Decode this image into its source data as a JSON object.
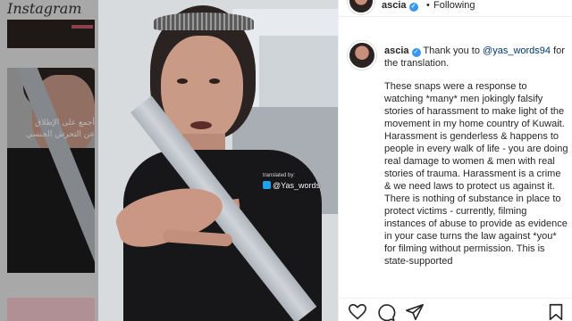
{
  "background_feed": {
    "logo_text": "Instagram",
    "arabic_caption_line1": "أجمع على الإطلاق",
    "arabic_caption_line2": "عن التحرش الجنسي"
  },
  "video": {
    "watermark_prefix": "translated by:",
    "watermark_handle": "@Yas_words"
  },
  "header": {
    "username": "ascia",
    "separator": "•",
    "follow_status": "Following"
  },
  "caption": {
    "username": "ascia",
    "thanks_text": "Thank you to",
    "mention": "@yas_words94",
    "thanks_suffix": "for the translation.",
    "body": "These snaps were a response to watching *many* men jokingly falsify stories of harassment to make light of the movement in my home country of Kuwait. Harassment is genderless & happens to people in every walk of life - you are doing real damage to women & men with real stories of trauma. Harassment is a crime & we need laws to protect us against it. There is nothing of substance in place to protect victims - currently, filming instances of abuse to provide as evidence in your case turns the law against *you* for filming without permission. This is state-supported"
  },
  "icons": {
    "verified": "verified-badge-icon",
    "like": "heart-icon",
    "comment": "comment-icon",
    "share": "paper-plane-icon",
    "save": "bookmark-icon"
  },
  "colors": {
    "verified_blue": "#3897f0",
    "mention_blue": "#00376b",
    "text": "#262626"
  }
}
